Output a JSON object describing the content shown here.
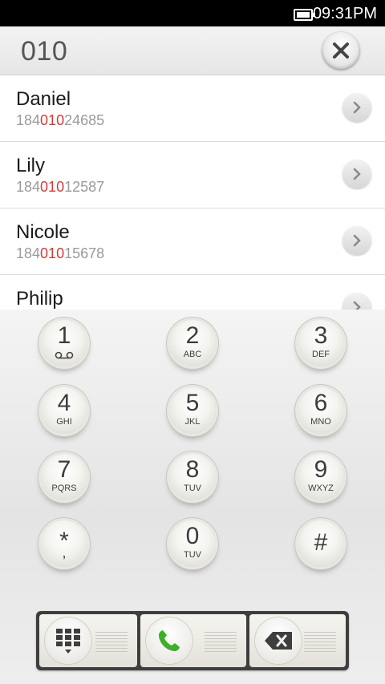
{
  "status_bar": {
    "time": "09:31PM"
  },
  "dialer": {
    "input": "010"
  },
  "contacts": [
    {
      "name": "Daniel",
      "number_prefix": "184",
      "number_match": "010",
      "number_suffix": "24685"
    },
    {
      "name": "Lily",
      "number_prefix": "184",
      "number_match": "010",
      "number_suffix": "12587"
    },
    {
      "name": "Nicole",
      "number_prefix": "184",
      "number_match": "010",
      "number_suffix": "15678"
    },
    {
      "name": "Philip",
      "number_prefix": "",
      "number_match": "",
      "number_suffix": ""
    }
  ],
  "keypad": [
    {
      "digit": "1",
      "letters": ""
    },
    {
      "digit": "2",
      "letters": "ABC"
    },
    {
      "digit": "3",
      "letters": "DEF"
    },
    {
      "digit": "4",
      "letters": "GHI"
    },
    {
      "digit": "5",
      "letters": "JKL"
    },
    {
      "digit": "6",
      "letters": "MNO"
    },
    {
      "digit": "7",
      "letters": "PQRS"
    },
    {
      "digit": "8",
      "letters": "TUV"
    },
    {
      "digit": "9",
      "letters": "WXYZ"
    },
    {
      "digit": "*",
      "letters": ","
    },
    {
      "digit": "0",
      "letters": "TUV"
    },
    {
      "digit": "#",
      "letters": ""
    }
  ],
  "icons": {
    "battery": "battery-icon",
    "clear": "close-icon",
    "detail": "chevron-right-icon",
    "voicemail": "voicemail-icon",
    "keypad_toggle": "dialpad-icon",
    "call": "phone-icon",
    "backspace": "backspace-icon"
  },
  "colors": {
    "match_highlight": "#d43a3a",
    "call_green": "#3fae2a"
  }
}
